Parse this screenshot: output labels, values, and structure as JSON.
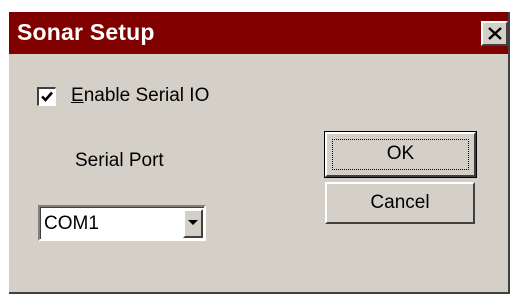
{
  "window": {
    "title": "Sonar Setup",
    "title_bar_color": "#800000",
    "face_color": "#d4d0c8"
  },
  "title_bar": {
    "close_icon": "close-x-icon"
  },
  "serial_io": {
    "label_mnemonic": "E",
    "label_rest": "nable Serial IO",
    "checked": true,
    "check_icon": "checkmark-icon"
  },
  "serial_port": {
    "label": "Serial Port",
    "selected": "COM1",
    "dropdown_icon": "chevron-down-icon"
  },
  "buttons": {
    "ok_label": "OK",
    "cancel_label": "Cancel"
  }
}
